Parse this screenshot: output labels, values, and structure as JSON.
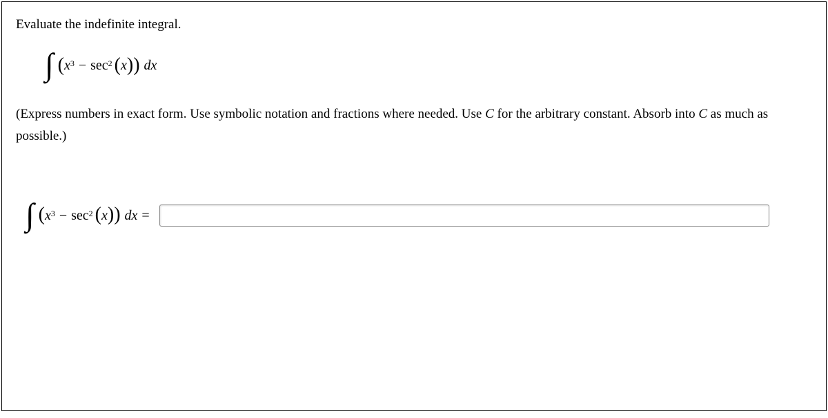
{
  "question": {
    "prompt": "Evaluate the indefinite integral.",
    "instruction_prefix": "(Express numbers in exact form. Use symbolic notation and fractions where needed. Use ",
    "instruction_const": "C",
    "instruction_mid": " for the arbitrary constant. Absorb into ",
    "instruction_const2": "C",
    "instruction_suffix": " as much as possible.)"
  },
  "math": {
    "int": "∫",
    "lparen": "(",
    "rparen": ")",
    "x": "x",
    "cube": "3",
    "minus": "−",
    "sec": "sec",
    "square": "2",
    "dx_d": "d",
    "dx_x": "x",
    "equals": "="
  },
  "answer": {
    "value": "",
    "placeholder": ""
  }
}
